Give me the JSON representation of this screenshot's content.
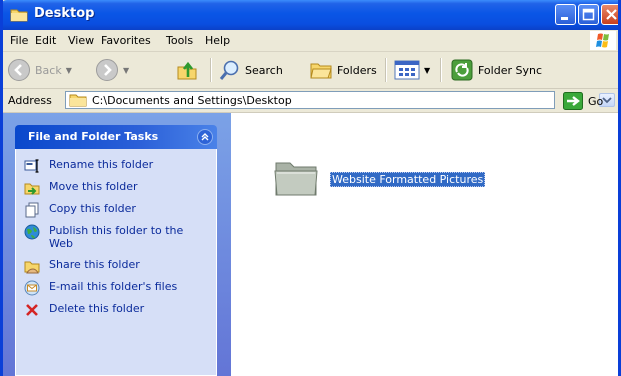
{
  "window": {
    "title": "Desktop"
  },
  "menubar": {
    "items": [
      "File",
      "Edit",
      "View",
      "Favorites",
      "Tools",
      "Help"
    ]
  },
  "toolbar": {
    "back_label": "Back",
    "search_label": "Search",
    "folders_label": "Folders",
    "folder_sync_label": "Folder Sync"
  },
  "address": {
    "label": "Address",
    "path": "C:\\Documents and Settings\\Desktop",
    "go_label": "Go"
  },
  "tasks": {
    "header": "File and Folder Tasks",
    "items": [
      {
        "label": "Rename this folder",
        "icon": "rename-icon"
      },
      {
        "label": "Move this folder",
        "icon": "move-icon"
      },
      {
        "label": "Copy this folder",
        "icon": "copy-icon"
      },
      {
        "label": "Publish this folder to the Web",
        "icon": "globe-icon"
      },
      {
        "label": "Share this folder",
        "icon": "share-icon"
      },
      {
        "label": "E-mail this folder's files",
        "icon": "email-icon"
      },
      {
        "label": "Delete this folder",
        "icon": "delete-icon"
      }
    ]
  },
  "files": [
    {
      "name": "Website Formatted Pictures",
      "type": "folder",
      "selected": true
    }
  ],
  "colors": {
    "title_bar": "#0a56e6",
    "task_pane": "#7ba2e7",
    "task_link": "#0b2b9b",
    "selection": "#316ac5"
  }
}
